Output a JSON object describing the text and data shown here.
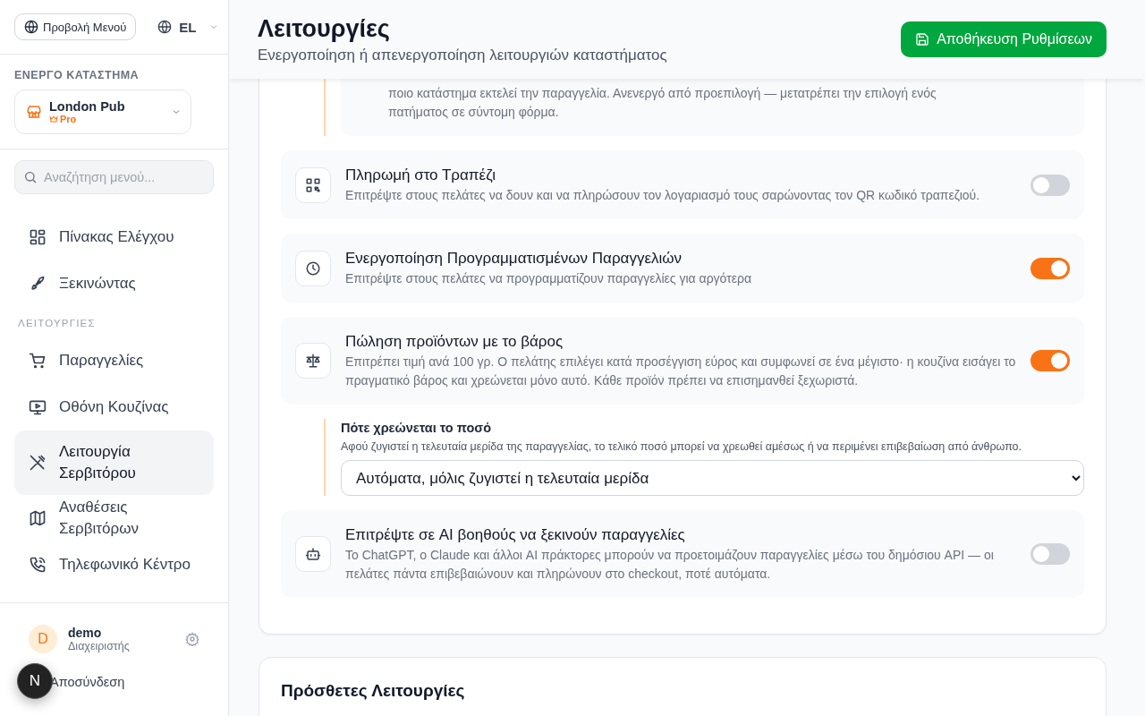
{
  "sidebar": {
    "menu_view_button": "Προβολή Μενού",
    "language": "EL",
    "store_section_label": "ΕΝΕΡΓΟ ΚΑΤΑΣΤΗΜΑ",
    "store": {
      "name": "London Pub",
      "plan": "Pro"
    },
    "search": {
      "placeholder": "Αναζήτηση μενού..."
    },
    "items": [
      {
        "kind": "link",
        "label": "Πίνακας Ελέγχου",
        "selected": false
      },
      {
        "kind": "link",
        "label": "Ξεκινώντας",
        "selected": false
      },
      {
        "kind": "section",
        "label": "ΛΕΙΤΟΥΡΓΙΕΣ"
      },
      {
        "kind": "link",
        "label": "Παραγγελίες",
        "selected": false
      },
      {
        "kind": "link",
        "label": "Οθόνη Κουζίνας",
        "selected": false
      },
      {
        "kind": "link",
        "label": "Λειτουργία Σερβιτόρου",
        "selected": true
      },
      {
        "kind": "link",
        "label": "Αναθέσεις Σερβιτόρων",
        "selected": false
      },
      {
        "kind": "link",
        "label": "Τηλεφωνικό Κέντρο",
        "selected": false
      }
    ],
    "user": {
      "initial": "D",
      "name": "demo",
      "role": "Διαχειριστής"
    },
    "logout": "Αποσύνδεση",
    "dev_badge": "N"
  },
  "header": {
    "title": "Λειτουργίες",
    "subtitle": "Ενεργοποίηση ή απενεργοποίηση λειτουργιών καταστήματος",
    "save_button": "Αποθήκευση Ρυθμίσεων"
  },
  "partial_setting": {
    "description": "ποιο κατάστημα εκτελεί την παραγγελία. Ανενεργό από προεπιλογή — μετατρέπει την επιλογή ενός πατήματος σε σύντομη φόρμα."
  },
  "features": [
    {
      "title": "Πληρωμή στο Τραπέζι",
      "description": "Επιτρέψτε στους πελάτες να δουν και να πληρώσουν τον λογαριασμό τους σαρώνοντας τον QR κωδικό τραπεζιού.",
      "on": false
    },
    {
      "title": "Ενεργοποίηση Προγραμματισμένων Παραγγελιών",
      "description": "Επιτρέψτε στους πελάτες να προγραμματίζουν παραγγελίες για αργότερα",
      "on": true
    },
    {
      "title": "Πώληση προϊόντων με το βάρος",
      "description": "Επιτρέπει τιμή ανά 100 γρ. Ο πελάτης επιλέγει κατά προσέγγιση εύρος και συμφωνεί σε ένα μέγιστο· η κουζίνα εισάγει το πραγματικό βάρος και χρεώνεται μόνο αυτό. Κάθε προϊόν πρέπει να επισημανθεί ξεχωριστά.",
      "on": true,
      "sub_setting": {
        "label": "Πότε χρεώνεται το ποσό",
        "description": "Αφού ζυγιστεί η τελευταία μερίδα της παραγγελίας, το τελικό ποσό μπορεί να χρεωθεί αμέσως ή να περιμένει επιβεβαίωση από άνθρωπο.",
        "value": "Αυτόματα, μόλις ζυγιστεί η τελευταία μερίδα"
      }
    },
    {
      "title": "Επιτρέψτε σε AI βοηθούς να ξεκινούν παραγγελίες",
      "description": "Το ChatGPT, ο Claude και άλλοι AI πράκτορες μπορούν να προετοιμάζουν παραγγελίες μέσω του δημόσιου API — οι πελάτες πάντα επιβεβαιώνουν και πληρώνουν στο checkout, ποτέ αυτόματα.",
      "on": false
    }
  ],
  "extra_card": {
    "title": "Πρόσθετες Λειτουργίες"
  }
}
